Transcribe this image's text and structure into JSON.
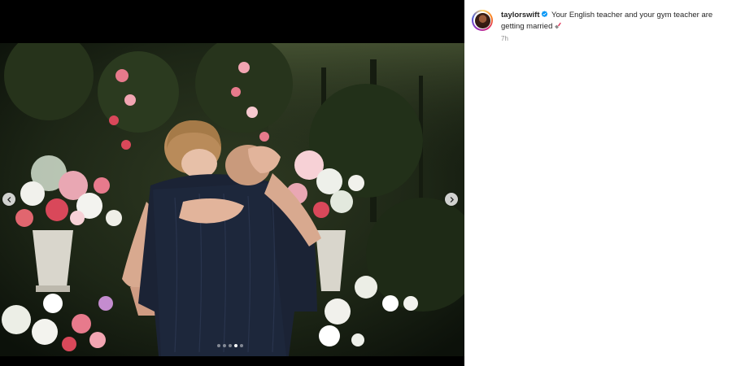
{
  "post": {
    "username": "taylorswift",
    "caption": "Your English teacher and your gym teacher are getting married",
    "time": "7h",
    "verified": true,
    "caption_emoji": "lipstick",
    "image_description_icon": "photo",
    "carousel": {
      "total": 5,
      "active_index": 3
    }
  },
  "colors": {
    "verified": "#0095f6",
    "text": "#262626",
    "muted": "#8e8e8e"
  }
}
